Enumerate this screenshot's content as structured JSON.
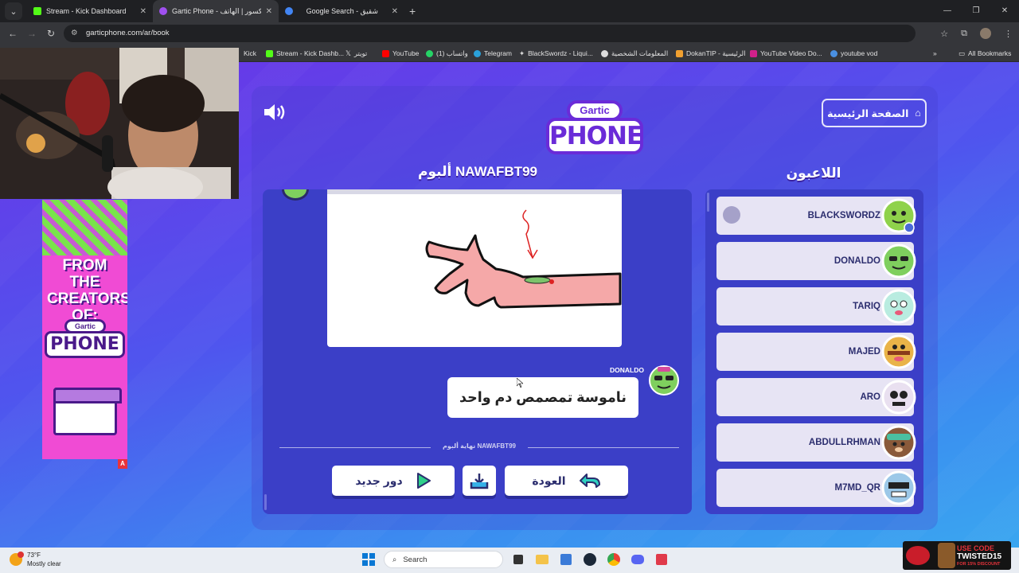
{
  "browser": {
    "tabs": [
      {
        "title": "Stream - Kick Dashboard",
        "icon_color": "#53fc18",
        "active": false
      },
      {
        "title": "Gartic Phone - الهاتف المكسور | الهاتف",
        "icon_color": "#a050f0",
        "active": true
      },
      {
        "title": "Google Search - شقيق",
        "icon_color": "#4285f4",
        "active": false
      }
    ],
    "url": "garticphone.com/ar/book",
    "bookmarks": [
      {
        "label": "Kick",
        "color": "#53fc18"
      },
      {
        "label": "Stream - Kick Dashb...",
        "color": "#53fc18"
      },
      {
        "label": "تويتر",
        "color": "#ffffff"
      },
      {
        "label": "YouTube",
        "color": "#ff0000"
      },
      {
        "label": "واتساب (1)",
        "color": "#25d366"
      },
      {
        "label": "Telegram",
        "color": "#2aa1da"
      },
      {
        "label": "BlackSwordz - Liqui...",
        "color": "#dddddd"
      },
      {
        "label": "المعلومات الشخصية",
        "color": "#dddddd"
      },
      {
        "label": "DokanTIP - الرئيسية",
        "color": "#f0a030"
      },
      {
        "label": "YouTube Video Do...",
        "color": "#d0208a"
      },
      {
        "label": "youtube vod",
        "color": "#4a90e2"
      }
    ],
    "all_bookmarks": "All Bookmarks"
  },
  "game": {
    "home_button": "الصفحة الرئيسية",
    "logo_top": "Gartic",
    "logo_bottom": "PHONE",
    "album_title": "ألبوم NAWAFBT99",
    "players_title": "اللاعبون",
    "speaker": "DONALDO",
    "caption": "ناموسة تمصمص دم واحد",
    "album_end": "نهاية ألبوم NAWAFBT99",
    "buttons": {
      "new_round": "دور جديد",
      "back": "العودة"
    },
    "players": [
      {
        "name": "BLACKSWORDZ",
        "avatar_color": "#8fd24b",
        "host": true
      },
      {
        "name": "DONALDO",
        "avatar_color": "#7fcf5e",
        "host": false
      },
      {
        "name": "TARIQ",
        "avatar_color": "#b9ece0",
        "host": false
      },
      {
        "name": "MAJED",
        "avatar_color": "#e9b348",
        "host": false
      },
      {
        "name": "ARO",
        "avatar_color": "#e9e0f0",
        "host": false
      },
      {
        "name": "ABDULLRHMAN",
        "avatar_color": "#8a5a3a",
        "host": false
      },
      {
        "name": "M7MD_QR",
        "avatar_color": "#9cc8e8",
        "host": false
      }
    ]
  },
  "ad": {
    "headline": "FROM THE CREATORS OF:",
    "logo_top": "Gartic",
    "logo_bottom": "PHONE",
    "badge": "A"
  },
  "taskbar": {
    "temp": "73°F",
    "condition": "Mostly clear",
    "search_placeholder": "Search"
  },
  "promo": {
    "line1": "USE CODE",
    "line2": "TWISTED15",
    "line3": "FOR 15% DISCOUNT"
  }
}
